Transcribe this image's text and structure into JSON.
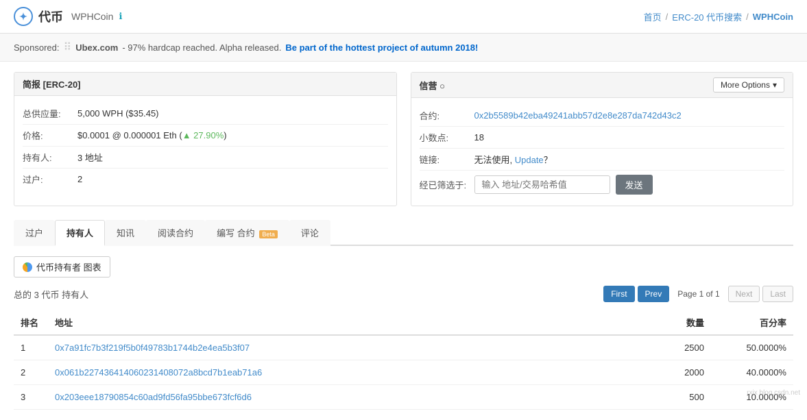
{
  "header": {
    "logo_text": "代币",
    "app_name": "WPHCoin",
    "info_icon": "ℹ",
    "nav": {
      "home": "首页",
      "separator1": "/",
      "erc20": "ERC-20 代币搜索",
      "separator2": "/",
      "current": "WPHCoin"
    }
  },
  "sponsored": {
    "label": "Sponsored:",
    "logo": "⠿",
    "name": "Ubex.com",
    "description": "- 97% hardcap reached. Alpha released.",
    "cta": "Be part of the hottest project of autumn 2018!"
  },
  "left_panel": {
    "title": "简报 [ERC-20]",
    "rows": [
      {
        "label": "总供应量:",
        "value": "5,000 WPH ($35.45)"
      },
      {
        "label": "价格:",
        "value": "$0.0001 @ 0.000001 Eth (▲ 27.90%)"
      },
      {
        "label": "持有人:",
        "value": "3 地址"
      },
      {
        "label": "过户:",
        "value": "2"
      }
    ]
  },
  "right_panel": {
    "title": "信营 ○",
    "more_options_label": "More Options",
    "rows": [
      {
        "label": "合约:",
        "value": "0x2b5589b42eba49241abb57d2e8e287da742d43c2",
        "is_link": true
      },
      {
        "label": "小数点:",
        "value": "18",
        "is_link": false
      },
      {
        "label": "链接:",
        "value": "无法使用, ",
        "link_text": "Update",
        "suffix": "？",
        "is_link": true
      },
      {
        "label": "经已筛选于:",
        "value": "",
        "is_input": true
      }
    ],
    "filter_placeholder": "输入 地址/交易哈希值",
    "filter_btn": "发送"
  },
  "tabs": [
    {
      "label": "过户",
      "active": false
    },
    {
      "label": "持有人",
      "active": true
    },
    {
      "label": "知讯",
      "active": false
    },
    {
      "label": "阅读合约",
      "active": false
    },
    {
      "label": "编写 合约",
      "active": false,
      "beta": true
    },
    {
      "label": "评论",
      "active": false
    }
  ],
  "holders_section": {
    "chart_btn_label": "代币持有者 图表",
    "holders_info": "总的 3 代币 持有人",
    "pagination": {
      "first": "First",
      "prev": "Prev",
      "page_info": "Page 1 of 1",
      "next": "Next",
      "last": "Last"
    },
    "table": {
      "columns": [
        "排名",
        "地址",
        "数量",
        "百分率"
      ],
      "rows": [
        {
          "rank": "1",
          "address": "0x7a91fc7b3f219f5b0f49783b1744b2e4ea5b3f07",
          "quantity": "2500",
          "percentage": "50.0000%"
        },
        {
          "rank": "2",
          "address": "0x061b227436414060231408072a8bcd7b1eab71a6",
          "quantity": "2000",
          "percentage": "40.0000%"
        },
        {
          "rank": "3",
          "address": "0x203eee18790854c60ad9fd56fa95bbe673fcf6d6",
          "quantity": "500",
          "percentage": "10.0000%"
        }
      ]
    }
  }
}
